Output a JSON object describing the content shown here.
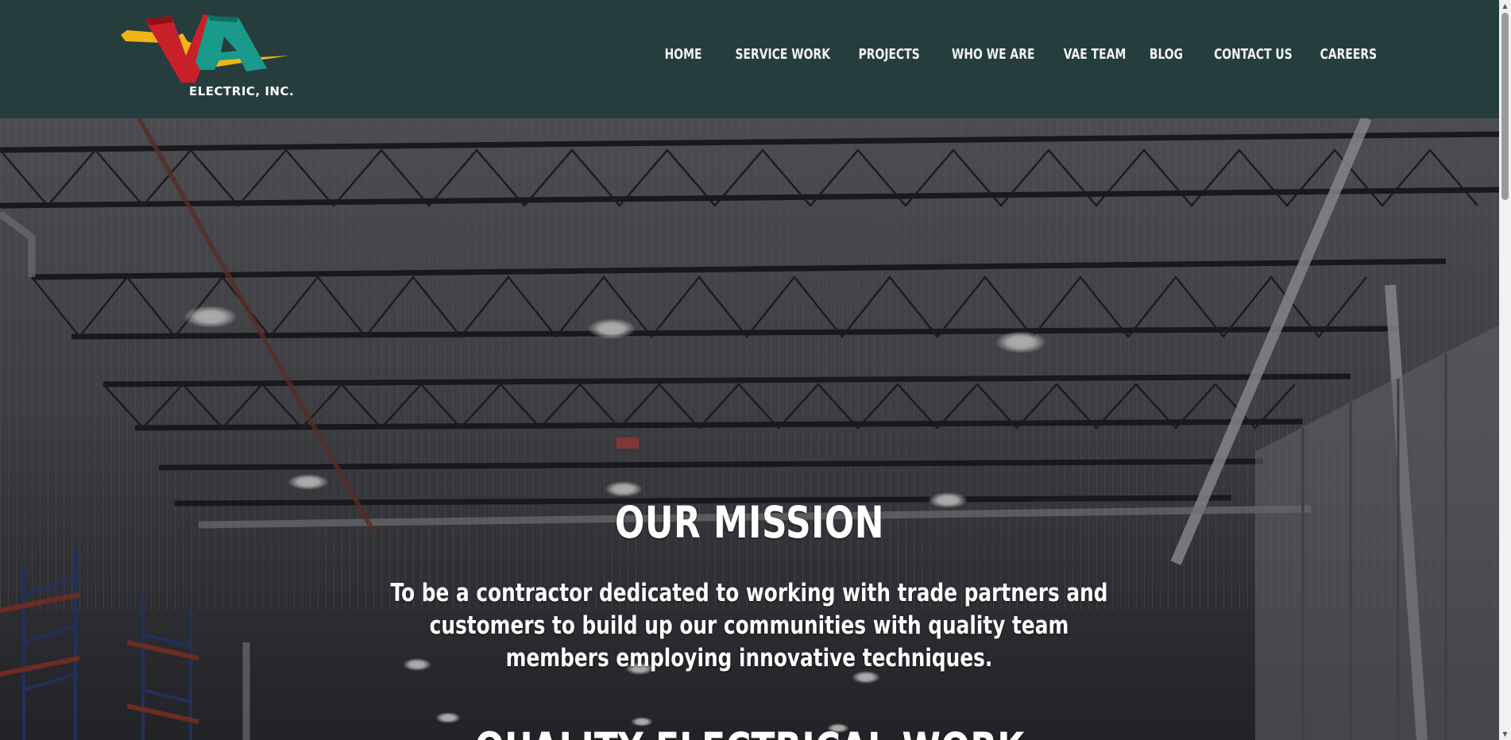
{
  "logo": {
    "subtitle": "ELECTRIC, INC.",
    "icon": "vae-logo-icon",
    "colors": {
      "red": "#c9202a",
      "teal": "#1a9a8a",
      "yellow": "#f0b418"
    }
  },
  "nav": {
    "items": [
      {
        "label": "HOME"
      },
      {
        "label": "SERVICE WORK"
      },
      {
        "label": "PROJECTS"
      },
      {
        "label": "WHO WE ARE"
      },
      {
        "label": "VAE TEAM"
      },
      {
        "label": "BLOG"
      },
      {
        "label": "CONTACT US"
      },
      {
        "label": "CAREERS"
      }
    ]
  },
  "hero": {
    "background": "warehouse-ceiling-photo",
    "mission_title": "OUR MISSION",
    "mission_text": "To be a contractor dedicated to working with trade partners and customers to build up our communities with quality team members employing innovative techniques.",
    "next_heading": "QUALITY ELECTRICAL WORK"
  },
  "colors": {
    "header_bg": "#263d3d",
    "nav_text": "#f2f2f2",
    "hero_text": "#ffffff"
  }
}
